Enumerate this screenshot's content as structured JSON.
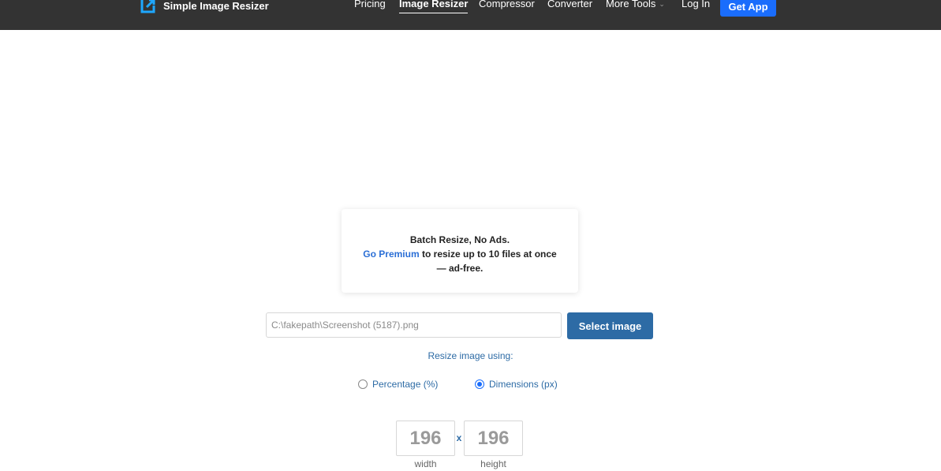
{
  "header": {
    "brand": "Simple Image Resizer",
    "nav": [
      {
        "label": "Pricing"
      },
      {
        "label": "Image Resizer",
        "active": true
      },
      {
        "label": "Compressor"
      },
      {
        "label": "Converter"
      },
      {
        "label": "More Tools",
        "icon": "chevron-down-icon"
      },
      {
        "label": "Log In"
      }
    ],
    "cta": "Get App"
  },
  "promo": {
    "title": "Batch Resize, No Ads.",
    "link": "Go Premium",
    "text": "to resize up to 10 files at once",
    "text2": "— ad-free."
  },
  "file": {
    "value": "C:\\fakepath\\Screenshot (5187).png",
    "button": "Select image"
  },
  "resize": {
    "label": "Resize image using:",
    "options": [
      {
        "label": "Percentage (%)",
        "checked": false
      },
      {
        "label": "Dimensions (px)",
        "checked": true
      }
    ]
  },
  "dimensions": {
    "width": "196",
    "height": "196",
    "separator": "x",
    "width_label": "width",
    "height_label": "height"
  },
  "colors": {
    "header_bg": "#333333",
    "accent": "#1a6dfc",
    "button": "#2d6ba5",
    "link": "#2b6fd6"
  }
}
